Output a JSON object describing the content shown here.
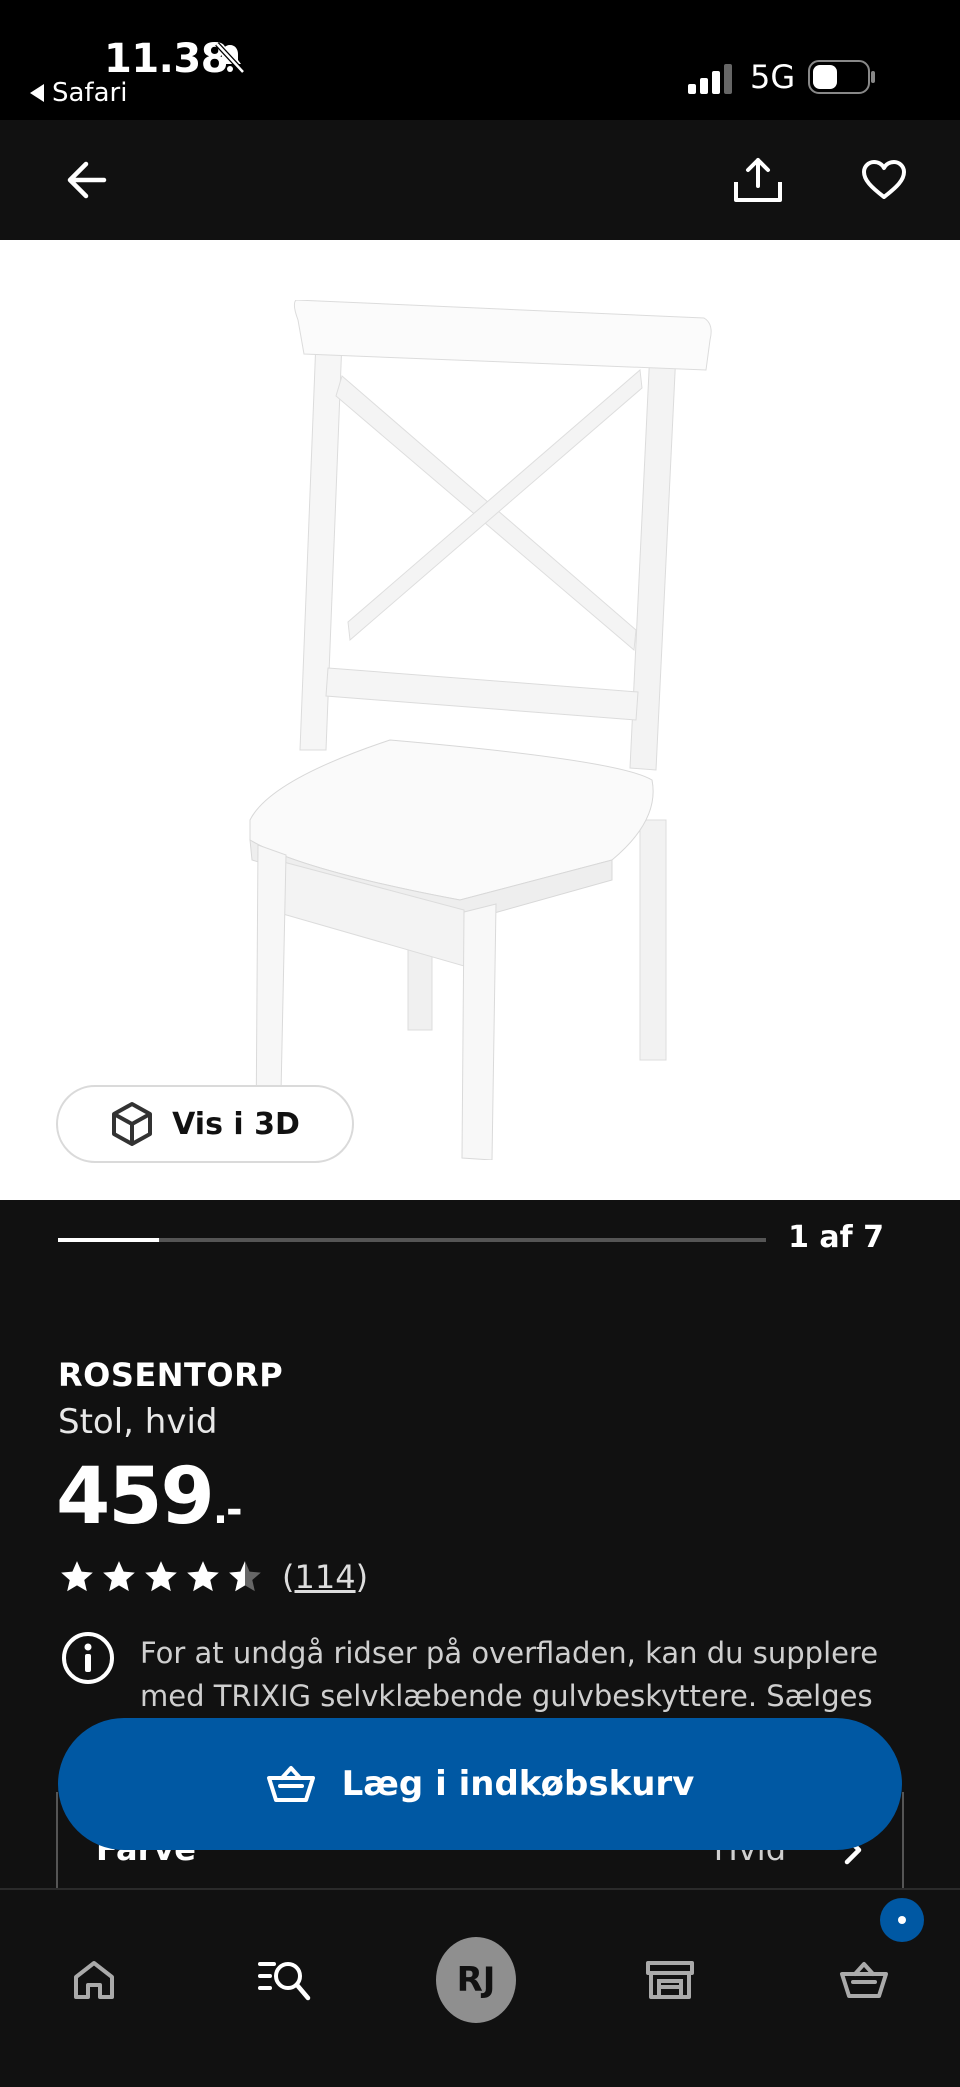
{
  "status_bar": {
    "time": "11.38",
    "back_app": "Safari",
    "network": "5G"
  },
  "top_nav": {
    "back_icon": "arrow-left-icon",
    "share_icon": "share-icon",
    "favorite_icon": "heart-icon"
  },
  "gallery": {
    "view_3d_label": "Vis i 3D",
    "counter": "1 af 7",
    "current_image": 1,
    "total_images": 7
  },
  "product": {
    "name": "ROSENTORP",
    "description": "Stol, hvid",
    "price": "459",
    "price_suffix": ".-",
    "rating_value": 4.5,
    "rating_max": 5,
    "review_count": "114",
    "review_open": "(",
    "review_close": ")",
    "info_text": "For at undgå ridser på overfladen, kan du supplere med TRIXIG selvklæbende gulvbeskyttere. Sælges"
  },
  "color_selector": {
    "label": "Farve",
    "value": "Hvid"
  },
  "add_to_cart": {
    "label": "Læg i indkøbskurv",
    "icon": "basket-icon"
  },
  "tabbar": {
    "items": [
      {
        "name": "home",
        "icon": "home-icon"
      },
      {
        "name": "search",
        "icon": "search-list-icon"
      },
      {
        "name": "profile",
        "initials": "RJ"
      },
      {
        "name": "stores",
        "icon": "store-icon"
      },
      {
        "name": "basket",
        "icon": "basket-icon"
      }
    ]
  },
  "colors": {
    "background": "#111111",
    "accent": "#0058a3",
    "image_background": "#ffffff"
  }
}
